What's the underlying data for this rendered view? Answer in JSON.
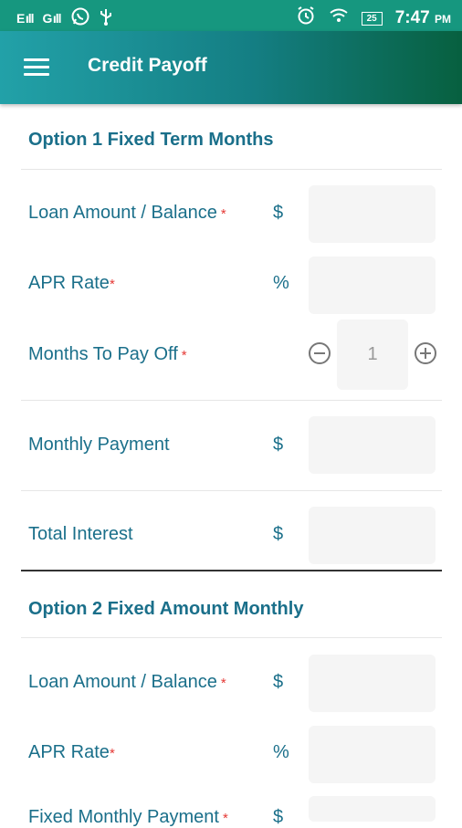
{
  "status_bar": {
    "signal_1": "E",
    "signal_2": "G",
    "battery": "25",
    "time": "7:47",
    "ampm": "PM"
  },
  "app_bar": {
    "title": "Credit Payoff",
    "menu_icon": "hamburger-menu-icon"
  },
  "option1": {
    "title": "Option 1 Fixed Term Months",
    "loan_amount_label": "Loan Amount / Balance",
    "loan_amount_unit": "$",
    "apr_label": "APR Rate",
    "apr_unit": "%",
    "months_label": "Months To Pay Off",
    "months_value": "1",
    "monthly_payment_label": "Monthly Payment",
    "monthly_payment_unit": "$",
    "total_interest_label": "Total Interest",
    "total_interest_unit": "$"
  },
  "option2": {
    "title": "Option 2 Fixed Amount Monthly",
    "loan_amount_label": "Loan Amount / Balance",
    "loan_amount_unit": "$",
    "apr_label": "APR Rate",
    "apr_unit": "%",
    "fixed_payment_label": "Fixed Monthly Payment",
    "fixed_payment_unit": "$"
  },
  "required_marker": "*",
  "colors": {
    "accent_text": "#1a6f8a",
    "required": "#e53935",
    "status_bar": "#16977f"
  }
}
